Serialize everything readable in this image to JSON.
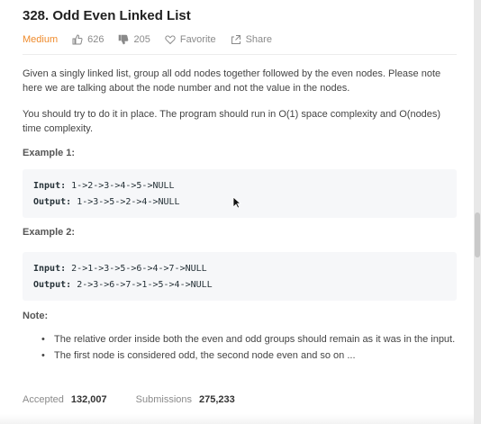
{
  "problem": {
    "title": "328. Odd Even Linked List",
    "difficulty": "Medium",
    "likes": "626",
    "dislikes": "205",
    "favorite_label": "Favorite",
    "share_label": "Share",
    "description": [
      "Given a singly linked list, group all odd nodes together followed by the even nodes. Please note here we are talking about the node number and not the value in the nodes.",
      "You should try to do it in place. The program should run in O(1) space complexity and O(nodes) time complexity."
    ],
    "examples": [
      {
        "title": "Example 1:",
        "input_label": "Input:",
        "input": "1->2->3->4->5->NULL",
        "output_label": "Output:",
        "output": "1->3->5->2->4->NULL"
      },
      {
        "title": "Example 2:",
        "input_label": "Input:",
        "input": "2->1->3->5->6->4->7->NULL",
        "output_label": "Output:",
        "output": "2->3->6->7->1->5->4->NULL"
      }
    ],
    "note_title": "Note:",
    "notes": [
      "The relative order inside both the even and odd groups should remain as it was in the input.",
      "The first node is considered odd, the second node even and so on ..."
    ],
    "stats": {
      "accepted_label": "Accepted",
      "accepted": "132,007",
      "submissions_label": "Submissions",
      "submissions": "275,233"
    }
  },
  "colors": {
    "difficulty_medium": "#ef8b2c",
    "code_background": "#f6f7f9"
  }
}
